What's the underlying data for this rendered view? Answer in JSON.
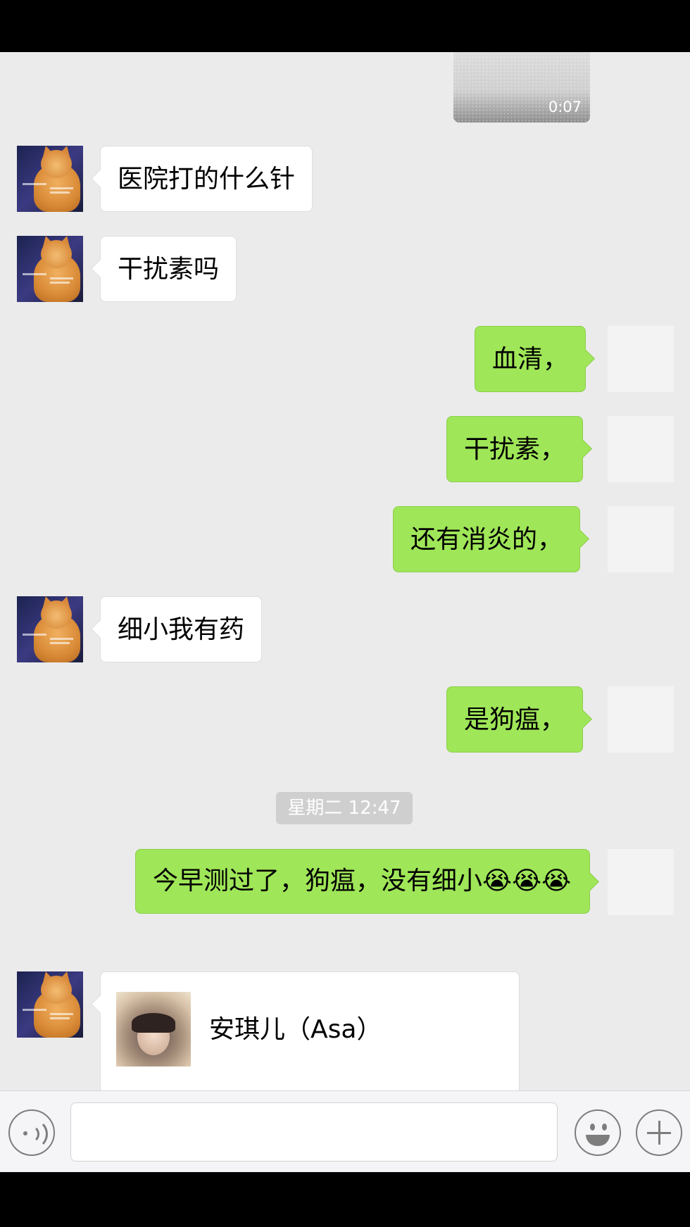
{
  "video": {
    "duration": "0:07"
  },
  "messages": {
    "m1": "医院打的什么针",
    "m2": "干扰素吗",
    "m3": "血清，",
    "m4": "干扰素，",
    "m5": "还有消炎的，",
    "m6": "细小我有药",
    "m7": "是狗瘟，",
    "m8_text": "今早测过了，狗瘟，没有细小",
    "m8_emoji": "😭😭😭"
  },
  "timestamp": "星期二 12:47",
  "card": {
    "name": "安琪儿（Asa）"
  },
  "input": {
    "placeholder": ""
  },
  "icons": {
    "voice": "voice-icon",
    "emoji": "emoji-icon",
    "plus": "plus-icon"
  },
  "colors": {
    "self_bubble": "#9fe658",
    "other_bubble": "#ffffff",
    "chat_bg": "#ebebeb"
  }
}
